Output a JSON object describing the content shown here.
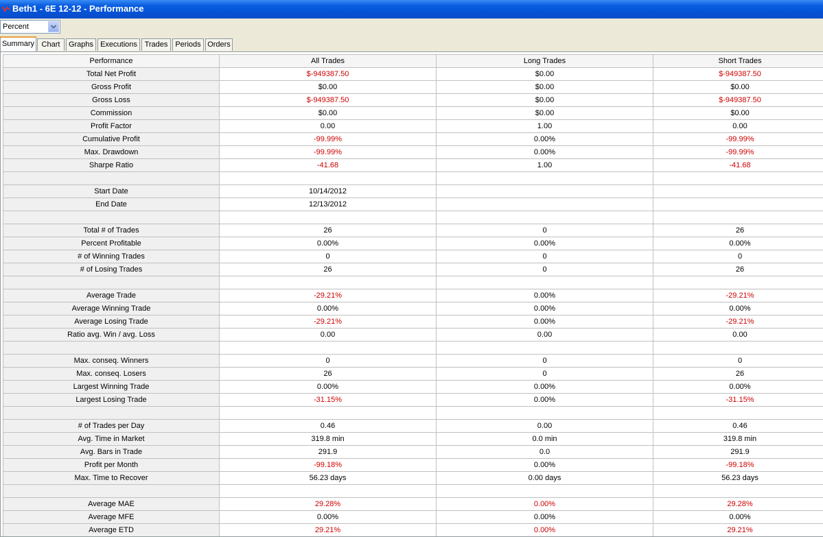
{
  "window": {
    "title": "Beth1 - 6E 12-12 - Performance"
  },
  "colors": {
    "negative": "#cc0000",
    "title_bar": "#0554d8",
    "active_tab_accent": "#e6a23c"
  },
  "display_mode": {
    "selected": "Percent"
  },
  "tabs": [
    {
      "label": "Summary",
      "active": true
    },
    {
      "label": "Chart"
    },
    {
      "label": "Graphs"
    },
    {
      "label": "Executions"
    },
    {
      "label": "Trades"
    },
    {
      "label": "Periods"
    },
    {
      "label": "Orders"
    }
  ],
  "table": {
    "columns": [
      "Performance",
      "All Trades",
      "Long Trades",
      "Short Trades"
    ],
    "rows": [
      {
        "label": "Total Net Profit",
        "all": "$-949387.50",
        "long": "$0.00",
        "short": "$-949387.50",
        "neg": [
          1,
          0,
          1
        ]
      },
      {
        "label": "Gross Profit",
        "all": "$0.00",
        "long": "$0.00",
        "short": "$0.00",
        "neg": [
          0,
          0,
          0
        ]
      },
      {
        "label": "Gross Loss",
        "all": "$-949387.50",
        "long": "$0.00",
        "short": "$-949387.50",
        "neg": [
          1,
          0,
          1
        ]
      },
      {
        "label": "Commission",
        "all": "$0.00",
        "long": "$0.00",
        "short": "$0.00",
        "neg": [
          0,
          0,
          0
        ]
      },
      {
        "label": "Profit Factor",
        "all": "0.00",
        "long": "1.00",
        "short": "0.00",
        "neg": [
          0,
          0,
          0
        ]
      },
      {
        "label": "Cumulative Profit",
        "all": "-99.99%",
        "long": "0.00%",
        "short": "-99.99%",
        "neg": [
          1,
          0,
          1
        ]
      },
      {
        "label": "Max. Drawdown",
        "all": "-99.99%",
        "long": "0.00%",
        "short": "-99.99%",
        "neg": [
          1,
          0,
          1
        ]
      },
      {
        "label": "Sharpe Ratio",
        "all": "-41.68",
        "long": "1.00",
        "short": "-41.68",
        "neg": [
          1,
          0,
          1
        ]
      },
      {
        "label": "",
        "all": "",
        "long": "",
        "short": "",
        "neg": [
          0,
          0,
          0
        ]
      },
      {
        "label": "Start Date",
        "all": "10/14/2012",
        "long": "",
        "short": "",
        "neg": [
          0,
          0,
          0
        ]
      },
      {
        "label": "End Date",
        "all": "12/13/2012",
        "long": "",
        "short": "",
        "neg": [
          0,
          0,
          0
        ]
      },
      {
        "label": "",
        "all": "",
        "long": "",
        "short": "",
        "neg": [
          0,
          0,
          0
        ]
      },
      {
        "label": "Total # of Trades",
        "all": "26",
        "long": "0",
        "short": "26",
        "neg": [
          0,
          0,
          0
        ]
      },
      {
        "label": "Percent Profitable",
        "all": "0.00%",
        "long": "0.00%",
        "short": "0.00%",
        "neg": [
          0,
          0,
          0
        ]
      },
      {
        "label": "# of Winning Trades",
        "all": "0",
        "long": "0",
        "short": "0",
        "neg": [
          0,
          0,
          0
        ]
      },
      {
        "label": "# of Losing Trades",
        "all": "26",
        "long": "0",
        "short": "26",
        "neg": [
          0,
          0,
          0
        ]
      },
      {
        "label": "",
        "all": "",
        "long": "",
        "short": "",
        "neg": [
          0,
          0,
          0
        ]
      },
      {
        "label": "Average Trade",
        "all": "-29.21%",
        "long": "0.00%",
        "short": "-29.21%",
        "neg": [
          1,
          0,
          1
        ]
      },
      {
        "label": "Average Winning Trade",
        "all": "0.00%",
        "long": "0.00%",
        "short": "0.00%",
        "neg": [
          0,
          0,
          0
        ]
      },
      {
        "label": "Average Losing Trade",
        "all": "-29.21%",
        "long": "0.00%",
        "short": "-29.21%",
        "neg": [
          1,
          0,
          1
        ]
      },
      {
        "label": "Ratio avg. Win / avg. Loss",
        "all": "0.00",
        "long": "0.00",
        "short": "0.00",
        "neg": [
          0,
          0,
          0
        ]
      },
      {
        "label": "",
        "all": "",
        "long": "",
        "short": "",
        "neg": [
          0,
          0,
          0
        ]
      },
      {
        "label": "Max. conseq. Winners",
        "all": "0",
        "long": "0",
        "short": "0",
        "neg": [
          0,
          0,
          0
        ]
      },
      {
        "label": "Max. conseq. Losers",
        "all": "26",
        "long": "0",
        "short": "26",
        "neg": [
          0,
          0,
          0
        ]
      },
      {
        "label": "Largest Winning Trade",
        "all": "0.00%",
        "long": "0.00%",
        "short": "0.00%",
        "neg": [
          0,
          0,
          0
        ]
      },
      {
        "label": "Largest Losing Trade",
        "all": "-31.15%",
        "long": "0.00%",
        "short": "-31.15%",
        "neg": [
          1,
          0,
          1
        ]
      },
      {
        "label": "",
        "all": "",
        "long": "",
        "short": "",
        "neg": [
          0,
          0,
          0
        ]
      },
      {
        "label": "# of Trades per Day",
        "all": "0.46",
        "long": "0.00",
        "short": "0.46",
        "neg": [
          0,
          0,
          0
        ]
      },
      {
        "label": "Avg. Time in Market",
        "all": "319.8 min",
        "long": "0.0 min",
        "short": "319.8 min",
        "neg": [
          0,
          0,
          0
        ]
      },
      {
        "label": "Avg. Bars in Trade",
        "all": "291.9",
        "long": "0.0",
        "short": "291.9",
        "neg": [
          0,
          0,
          0
        ]
      },
      {
        "label": "Profit per Month",
        "all": "-99.18%",
        "long": "0.00%",
        "short": "-99.18%",
        "neg": [
          1,
          0,
          1
        ]
      },
      {
        "label": "Max. Time to Recover",
        "all": "56.23 days",
        "long": "0.00 days",
        "short": "56.23 days",
        "neg": [
          0,
          0,
          0
        ]
      },
      {
        "label": "",
        "all": "",
        "long": "",
        "short": "",
        "neg": [
          0,
          0,
          0
        ]
      },
      {
        "label": "Average MAE",
        "all": "29.28%",
        "long": "0.00%",
        "short": "29.28%",
        "neg": [
          1,
          1,
          1
        ]
      },
      {
        "label": "Average MFE",
        "all": "0.00%",
        "long": "0.00%",
        "short": "0.00%",
        "neg": [
          0,
          0,
          0
        ]
      },
      {
        "label": "Average ETD",
        "all": "29.21%",
        "long": "0.00%",
        "short": "29.21%",
        "neg": [
          1,
          1,
          1
        ]
      }
    ]
  }
}
